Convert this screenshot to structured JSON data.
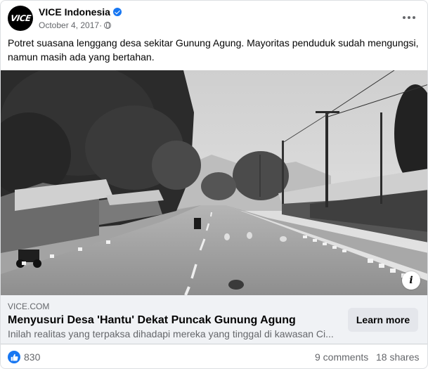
{
  "header": {
    "avatar_text": "VICE",
    "page_name": "VICE Indonesia",
    "date": "October 4, 2017",
    "verified_icon": "verified-badge-icon",
    "privacy_icon": "globe-icon",
    "more_icon": "more-options-icon"
  },
  "post": {
    "caption": "Potret suasana lenggang desa sekitar Gunung Agung. Mayoritas penduduk sudah mengungsi, namun masih ada yang bertahan."
  },
  "link": {
    "domain": "VICE.COM",
    "title": "Menyusuri Desa 'Hantu' Dekat Puncak Gunung Agung",
    "description": "Inilah realitas yang terpaksa dihadapi mereka yang tinggal di kawasan Ci...",
    "button_label": "Learn more",
    "info_label": "i"
  },
  "footer": {
    "like_count": "830",
    "comments": "9 comments",
    "shares": "18 shares"
  },
  "colors": {
    "accent": "#1877f2",
    "secondary_text": "#65676b",
    "link_box_bg": "#f0f2f5"
  }
}
